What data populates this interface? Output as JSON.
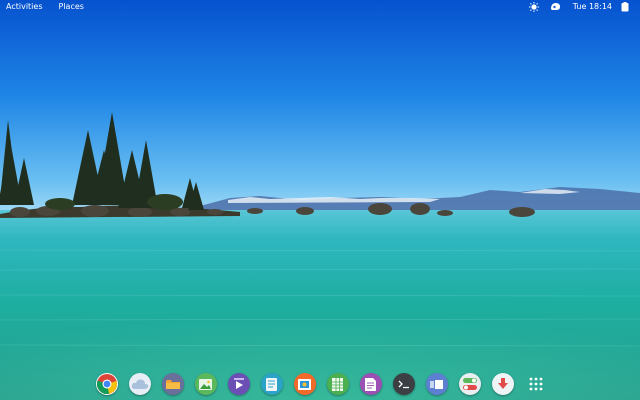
{
  "topbar": {
    "activities_label": "Activities",
    "places_label": "Places",
    "clock": "Tue 18:14"
  },
  "tray": {
    "icons": [
      "brightness-icon",
      "network-icon",
      "power-icon"
    ]
  },
  "dock": {
    "items": [
      {
        "icon": "chrome-icon"
      },
      {
        "icon": "weather-icon"
      },
      {
        "icon": "files-icon"
      },
      {
        "icon": "image-viewer-icon"
      },
      {
        "icon": "video-player-icon"
      },
      {
        "icon": "text-editor-icon"
      },
      {
        "icon": "screenshot-icon"
      },
      {
        "icon": "spreadsheet-icon"
      },
      {
        "icon": "document-viewer-icon"
      },
      {
        "icon": "terminal-icon"
      },
      {
        "icon": "window-switcher-icon"
      },
      {
        "icon": "settings-toggle-icon"
      },
      {
        "icon": "software-update-icon"
      },
      {
        "icon": "show-apps-icon"
      }
    ]
  },
  "colors": {
    "sky_top": "#0a5fd6",
    "sky_horizon": "#8fd2f5",
    "water": "#24b5b0",
    "topbar_text": "#ffffff"
  }
}
